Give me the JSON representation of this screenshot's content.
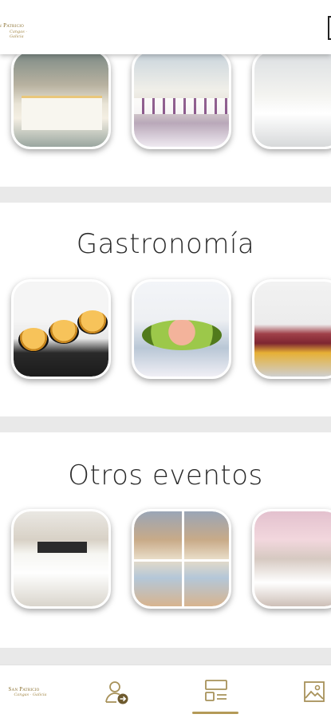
{
  "app": {
    "brand_name": "San Patricio",
    "brand_tagline": "Cangas · Galicia"
  },
  "sections": [
    {
      "id": "salones",
      "title": "",
      "photos": [
        "hall-buffet",
        "hall-banquet-purple",
        "hall-banquet-white"
      ]
    },
    {
      "id": "gastronomia",
      "title": "Gastronomía",
      "photos": [
        "sea-urchins",
        "avocado-shrimp",
        "seared-tuna"
      ]
    },
    {
      "id": "otros-eventos",
      "title": "Otros eventos",
      "photos": [
        "conference-room",
        "kids-party-collage",
        "party-balloons"
      ]
    }
  ],
  "bottom_nav": {
    "items": [
      {
        "name": "home-logo",
        "label": "San Patricio"
      },
      {
        "name": "contact-icon",
        "icon": "user-arrow-icon"
      },
      {
        "name": "sections-icon",
        "icon": "cards-list-icon",
        "active": true
      },
      {
        "name": "gallery-icon",
        "icon": "image-icon"
      }
    ],
    "accent_color": "#b49a57",
    "icon_color": "#a8925a"
  },
  "colors": {
    "band": "#e9e9e9",
    "brand_gold": "#8a7030"
  }
}
